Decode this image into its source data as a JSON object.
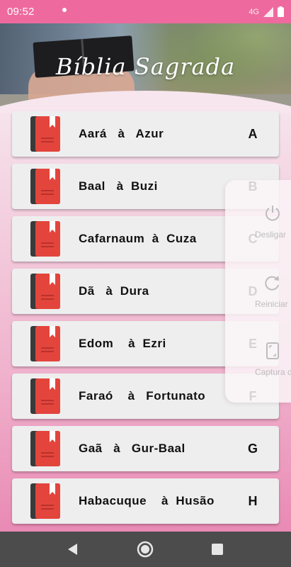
{
  "status_bar": {
    "time": "09:52",
    "network": "4G"
  },
  "header": {
    "title": "Bíblia Sagrada"
  },
  "items": [
    {
      "label": "Aará   à   Azur",
      "letter": "A"
    },
    {
      "label": "Baal   à  Buzi",
      "letter": "B"
    },
    {
      "label": "Cafarnaum  à  Cuza",
      "letter": "C"
    },
    {
      "label": "Dã   à  Dura",
      "letter": "D"
    },
    {
      "label": "Edom    à  Ezri",
      "letter": "E"
    },
    {
      "label": "Faraó    à   Fortunato",
      "letter": "F"
    },
    {
      "label": "Gaã   à   Gur-Baal",
      "letter": "G"
    },
    {
      "label": "Habacuque    à  Husão",
      "letter": "H"
    }
  ],
  "power_menu": {
    "items": [
      {
        "label": "Desligar",
        "icon": "power-icon"
      },
      {
        "label": "Reiniciar",
        "icon": "restart-icon"
      },
      {
        "label": "Captura de",
        "icon": "screenshot-icon"
      }
    ]
  },
  "colors": {
    "status_bar": "#ee6a9e",
    "book_red": "#e3453c",
    "book_spine": "#3a3a3a",
    "nav_bar": "#4c4c4c"
  },
  "nav": {
    "icons": [
      "back-icon",
      "home-icon",
      "recents-icon"
    ]
  }
}
